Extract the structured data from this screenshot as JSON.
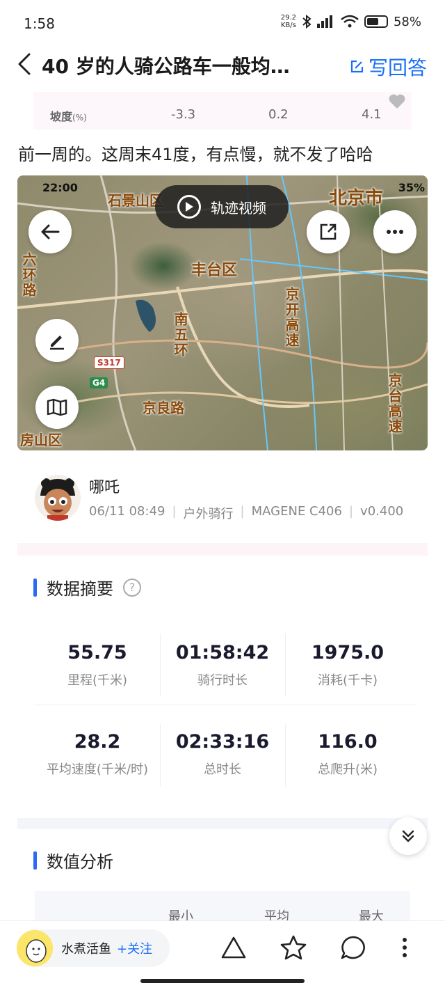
{
  "status": {
    "time": "1:58",
    "net_speed_value": "29.2",
    "net_speed_unit": "KB/s",
    "battery": "58"
  },
  "header": {
    "title": "40 岁的人骑公路车一般均…",
    "write_answer": "写回答"
  },
  "slope": {
    "label": "坡度",
    "unit": "(%)",
    "values": [
      "-3.3",
      "0.2",
      "4.1"
    ]
  },
  "post_text": "前一周的。这周末41度，有点慢，就不发了哈哈",
  "map": {
    "phone_time": "22:00",
    "phone_battery": "35%",
    "video_label": "轨迹视频",
    "labels": {
      "fengtai": "丰台区",
      "beijing": "北京市",
      "south_fifth_ring": "南五环",
      "jingkai": "京开高速",
      "jingliang": "京良路",
      "jingtai": "京台高速",
      "west_ring": "六环路",
      "shijingshan": "石景山区",
      "fangshan": "房山区"
    },
    "signs": {
      "s317": "S317",
      "g4": "G4"
    }
  },
  "profile": {
    "name": "哪吒",
    "datetime": "06/11 08:49",
    "activity": "户外骑行",
    "device": "MAGENE C406",
    "version": "v0.400"
  },
  "summary": {
    "title": "数据摘要",
    "help": "?",
    "stats": [
      {
        "value": "55.75",
        "label": "里程(千米)"
      },
      {
        "value": "01:58:42",
        "label": "骑行时长"
      },
      {
        "value": "1975.0",
        "label": "消耗(千卡)"
      },
      {
        "value": "28.2",
        "label": "平均速度(千米/时)"
      },
      {
        "value": "02:33:16",
        "label": "总时长"
      },
      {
        "value": "116.0",
        "label": "总爬升(米)"
      }
    ]
  },
  "analysis": {
    "title": "数值分析",
    "columns": [
      "最小",
      "平均",
      "最大"
    ]
  },
  "bottom": {
    "author": "水煮活鱼",
    "follow": "+关注"
  },
  "colors": {
    "accent": "#1b6ff5",
    "section_bar": "#2b6bf0"
  }
}
